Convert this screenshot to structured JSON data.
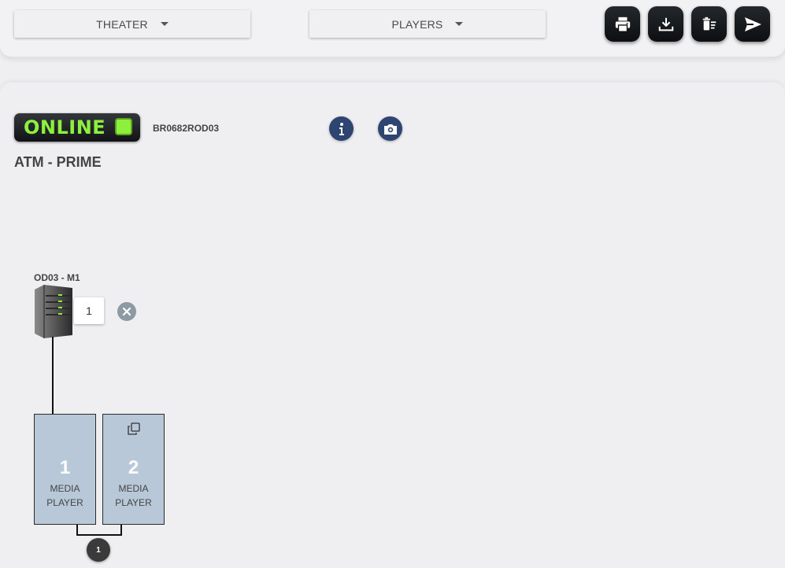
{
  "toolbar": {
    "theater_dropdown": {
      "label": "THEATER",
      "icon": "caret-down-icon"
    },
    "players_dropdown": {
      "label": "PLAYERS",
      "icon": "caret-down-icon"
    },
    "actions": [
      {
        "icon": "print-icon"
      },
      {
        "icon": "download-icon"
      },
      {
        "icon": "delete-list-icon"
      },
      {
        "icon": "send-icon"
      }
    ]
  },
  "status": {
    "label": "ONLINE",
    "color": "#8df03c"
  },
  "device": {
    "serial": "BR0682ROD03",
    "site_name": "ATM - PRIME",
    "info_icon": "info-icon",
    "camera_icon": "camera-icon"
  },
  "server": {
    "label": "OD03 - M1",
    "count": "1",
    "remove_icon": "close-icon"
  },
  "players": [
    {
      "number": "1",
      "label_line1": "MEDIA",
      "label_line2": "PLAYER"
    },
    {
      "number": "2",
      "label_line1": "MEDIA",
      "label_line2": "PLAYER",
      "icon": "duplicate-icon"
    }
  ],
  "group": {
    "count": "1"
  },
  "colors": {
    "player_fill": "#b8c8d8",
    "action_dark": "#2d4570"
  }
}
